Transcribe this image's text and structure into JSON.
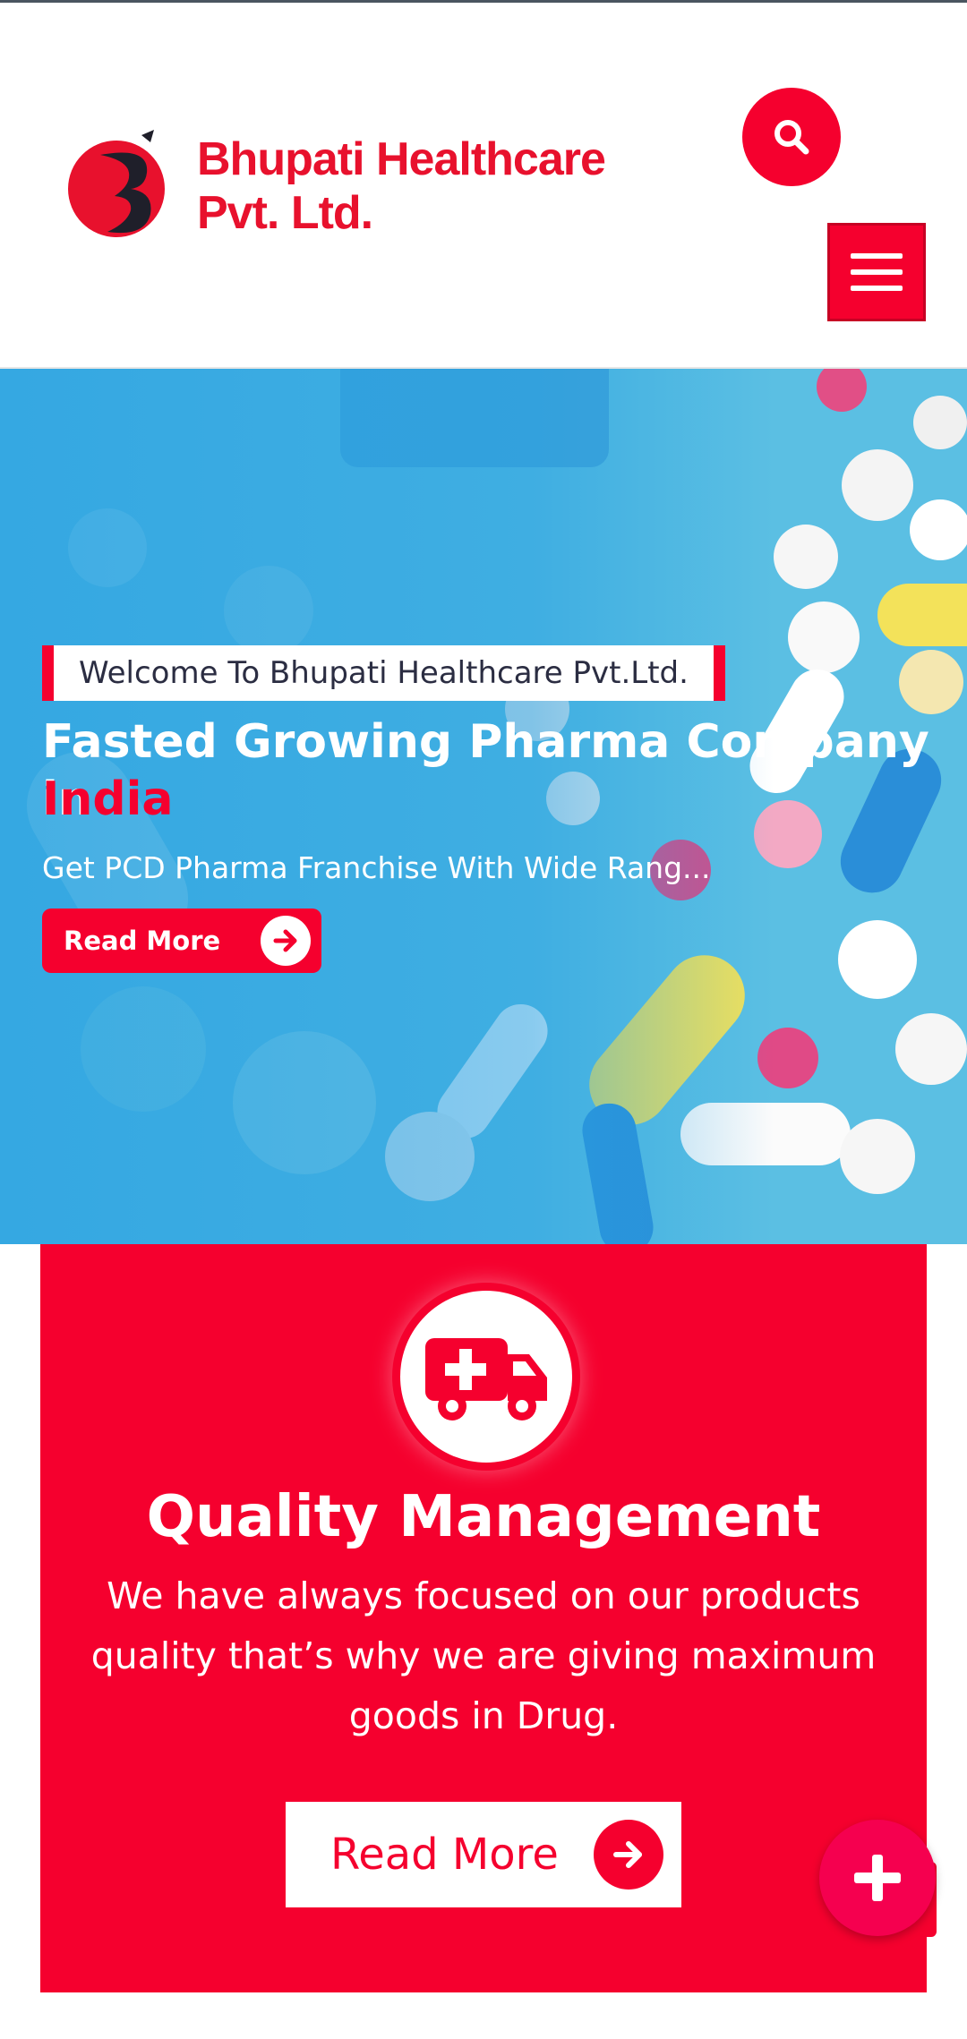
{
  "colors": {
    "accent": "#f5002e",
    "hero_blue": "#3aa6dc",
    "text_dark": "#2b2d42",
    "white": "#ffffff"
  },
  "header": {
    "brand": "Bhupati Healthcare Pvt. Ltd.",
    "search_icon": "search-icon",
    "menu_icon": "hamburger-icon"
  },
  "hero": {
    "welcome": "Welcome To Bhupati Healthcare Pvt.Ltd.",
    "title": "Fasted Growing Pharma Company in",
    "title_accent": "India",
    "subtitle": "Get PCD Pharma Franchise With Wide Rang...",
    "button_label": "Read More",
    "button_icon": "arrow-right-icon"
  },
  "feature": {
    "icon": "ambulance-icon",
    "title": "Quality Management",
    "text": "We have always focused on our products quality that’s why we are giving maximum goods in Drug.",
    "button_label": "Read More",
    "button_icon": "arrow-right-icon"
  },
  "fab": {
    "icon": "plus-icon"
  }
}
